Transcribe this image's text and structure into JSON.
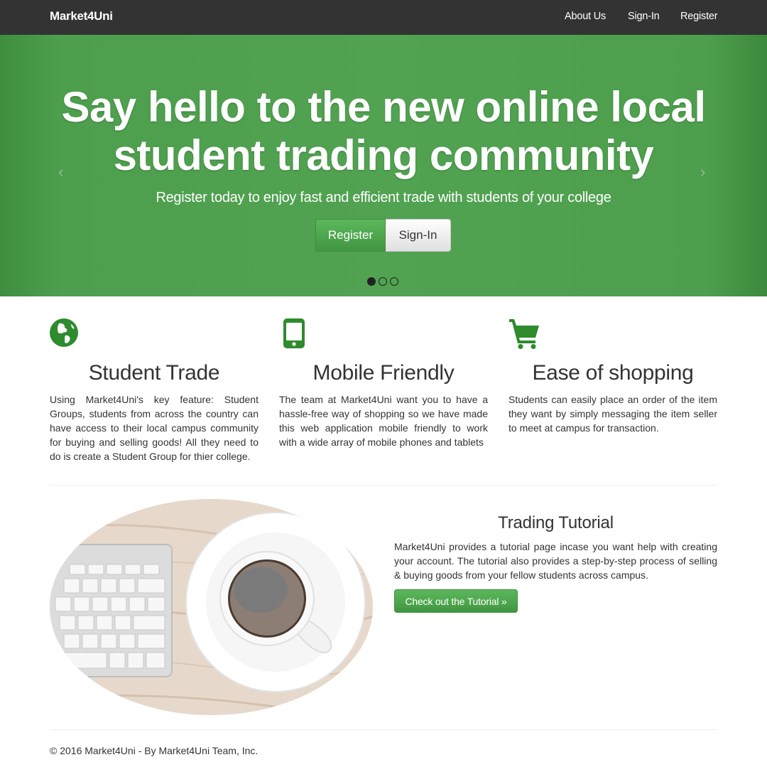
{
  "navbar": {
    "brand": "Market4Uni",
    "links": [
      "About Us",
      "Sign-In",
      "Register"
    ]
  },
  "hero": {
    "title_line1": "Say hello to the new online local",
    "title_line2": "student trading community",
    "subtitle": "Register today to enjoy fast and efficient trade with students of your college",
    "register_label": "Register",
    "signin_label": "Sign-In",
    "prev_arrow": "‹",
    "next_arrow": "›",
    "slide_count": 3,
    "active_slide": 1
  },
  "features": [
    {
      "icon": "globe-icon",
      "title": "Student Trade",
      "text": "Using Market4Uni's key feature: Student Groups, students from across the country can have access to their local campus community for buying and selling goods! All they need to do is create a Student Group for thier college."
    },
    {
      "icon": "mobile-phone-icon",
      "title": "Mobile Friendly",
      "text": "The team at Market4Uni want you to have a hassle-free way of shopping so we have made this web application mobile friendly to work with a wide array of mobile phones and tablets"
    },
    {
      "icon": "shopping-cart-icon",
      "title": "Ease of shopping",
      "text": "Students can easily place an order of the item they want by simply messaging the item seller to meet at campus for transaction."
    }
  ],
  "tutorial": {
    "title": "Trading Tutorial",
    "text": "Market4Uni provides a tutorial page incase you want help with creating your account. The tutorial also provides a step-by-step process of selling & buying goods from your fellow students across campus.",
    "button_label": "Check out the Tutorial »",
    "image": "keyboard-and-coffee-cup-photo"
  },
  "footer": {
    "text": "© 2016 Market4Uni - By Market4Uni Team, Inc."
  },
  "colors": {
    "navbar": "#333333",
    "hero_green": "#51a351",
    "accent_green": "#449d44",
    "icon_green": "#2e8b2e"
  }
}
